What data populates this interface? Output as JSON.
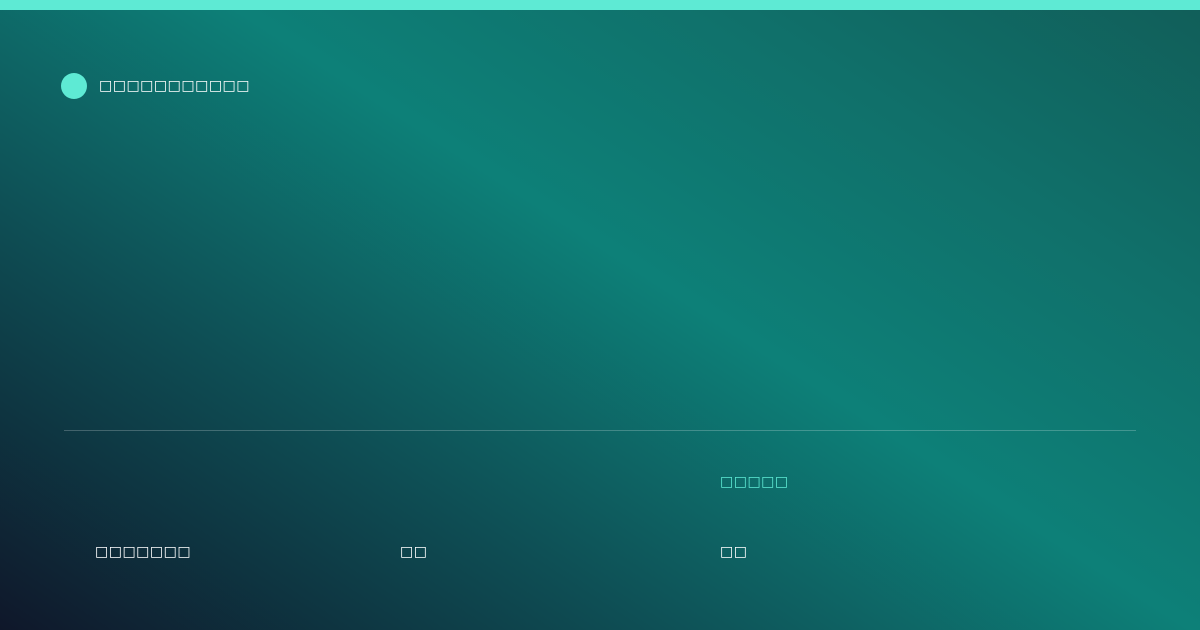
{
  "colors": {
    "accent": "#5eead4",
    "background_dark": "#0f172a",
    "background_teal": "#0d8078"
  },
  "brand": {
    "icon": "circle-dot-icon",
    "name": "□□□□□□□□□□□"
  },
  "footer": {
    "label": "□□□□□",
    "values": [
      "□□□□□□□",
      "□□",
      "□□"
    ]
  }
}
